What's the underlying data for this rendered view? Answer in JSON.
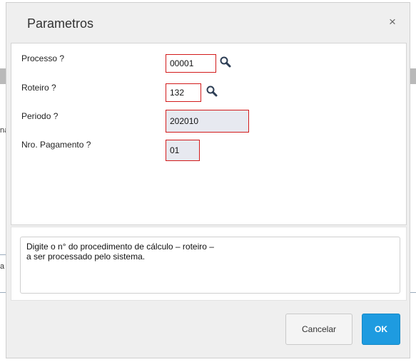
{
  "dialog": {
    "title": "Parametros",
    "close_label": "×"
  },
  "params": [
    {
      "label": "Processo ?",
      "value": "00001",
      "editable": true,
      "lookup": true
    },
    {
      "label": "Roteiro ?",
      "value": "132",
      "editable": true,
      "lookup": true
    },
    {
      "label": "Periodo ?",
      "value": "202010",
      "editable": false,
      "lookup": false
    },
    {
      "label": "Nro. Pagamento ?",
      "value": "01",
      "editable": false,
      "lookup": false
    }
  ],
  "help": {
    "line1": "Digite o n° do procedimento de cálculo – roteiro –",
    "line2": "a ser processado pelo sistema."
  },
  "buttons": {
    "cancel": "Cancelar",
    "ok": "OK"
  },
  "background": {
    "left_text_1": "na",
    "left_text_2": "a"
  },
  "colors": {
    "field_border": "#d21a1a",
    "readonly_bg": "#e7e9f0",
    "ok_button": "#1e9be0"
  }
}
